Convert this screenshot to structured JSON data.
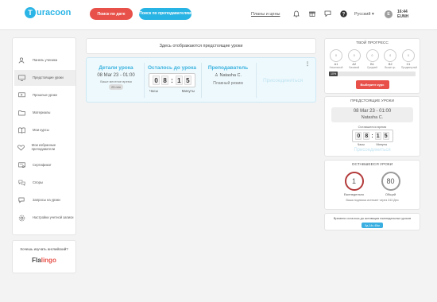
{
  "header": {
    "logo_letter": "T",
    "logo_text": "uracoon",
    "search_by_date": "Поиск по дате",
    "search_by_teachers": "Поиск по преподавателям",
    "plans_link": "Планы и цены",
    "language": "Русский",
    "avatar_initial": "E",
    "time": "16:44",
    "weekday": "EUNH"
  },
  "sidebar": {
    "items": [
      {
        "label": "Панель ученика",
        "icon": "user-icon"
      },
      {
        "label": "Предстоящие уроки",
        "icon": "monitor-icon"
      },
      {
        "label": "Прошлые уроки",
        "icon": "history-icon"
      },
      {
        "label": "Материалы",
        "icon": "folder-icon"
      },
      {
        "label": "Мои курсы",
        "icon": "book-icon"
      },
      {
        "label": "Мои избранные преподаватели",
        "icon": "heart-icon"
      },
      {
        "label": "Сертификат",
        "icon": "certificate-icon"
      },
      {
        "label": "Споры",
        "icon": "dispute-icon"
      },
      {
        "label": "Запросы на уроки",
        "icon": "request-icon"
      },
      {
        "label": "Настройки учетной записи",
        "icon": "settings-icon"
      }
    ],
    "active_index": 1
  },
  "promo": {
    "question": "Хочешь изучать английский?",
    "brand_part1": "Fla",
    "brand_part2": "lingo"
  },
  "main": {
    "upcoming_header": "Здесь отображаются предстоящие уроки",
    "lesson": {
      "details_title": "Детали урока",
      "date": "08 Mar 23 - 01:00",
      "local_time_label": "Ваше местное время",
      "duration": "25 min",
      "countdown_title": "Осталось до урока",
      "digits": [
        "0",
        "8",
        "1",
        "5"
      ],
      "hours_label": "Часы",
      "minutes_label": "Минуты",
      "teacher_title": "Преподаватель",
      "teacher_name": "Natasha C.",
      "mode": "Плавный режим",
      "status": "Присоединиться"
    }
  },
  "progress": {
    "title": "ТВОЙ ПРОГРЕСС",
    "levels": [
      {
        "code": "A1",
        "name": "Начальный"
      },
      {
        "code": "A2",
        "name": "Базовый"
      },
      {
        "code": "B1",
        "name": "Средний"
      },
      {
        "code": "B2",
        "name": "Выше ср."
      },
      {
        "code": "C1",
        "name": "Продвинутый"
      }
    ],
    "level_circle_text": "0",
    "percent_label": "10%",
    "percent": 10,
    "choose_course": "Выберите курс"
  },
  "upcoming": {
    "title": "ПРЕДСТОЯЩИЕ УРОКИ",
    "date": "08 Mar 23 - 01:00",
    "teacher": "Natasha C.",
    "time_left_label": "Оставшееся время",
    "digits": [
      "0",
      "8",
      "1",
      "5"
    ],
    "hours_label": "Часы",
    "minutes_label": "Минуты",
    "status": "Присоединиться"
  },
  "remaining": {
    "title": "ОСТАВШЕЕСЯ УРОКИ",
    "weekly_count": "1",
    "weekly_label": "Еженедельно",
    "total_count": "80",
    "total_label": "Общий",
    "note": "Ваша подписка истекает через 243 Дни"
  },
  "countdown": {
    "text": "Времени осталось до активации еженедельных уроков",
    "value": "5д 14ч 45м"
  },
  "colors": {
    "brand_blue": "#2bb5e6",
    "brand_red": "#e8514a"
  }
}
